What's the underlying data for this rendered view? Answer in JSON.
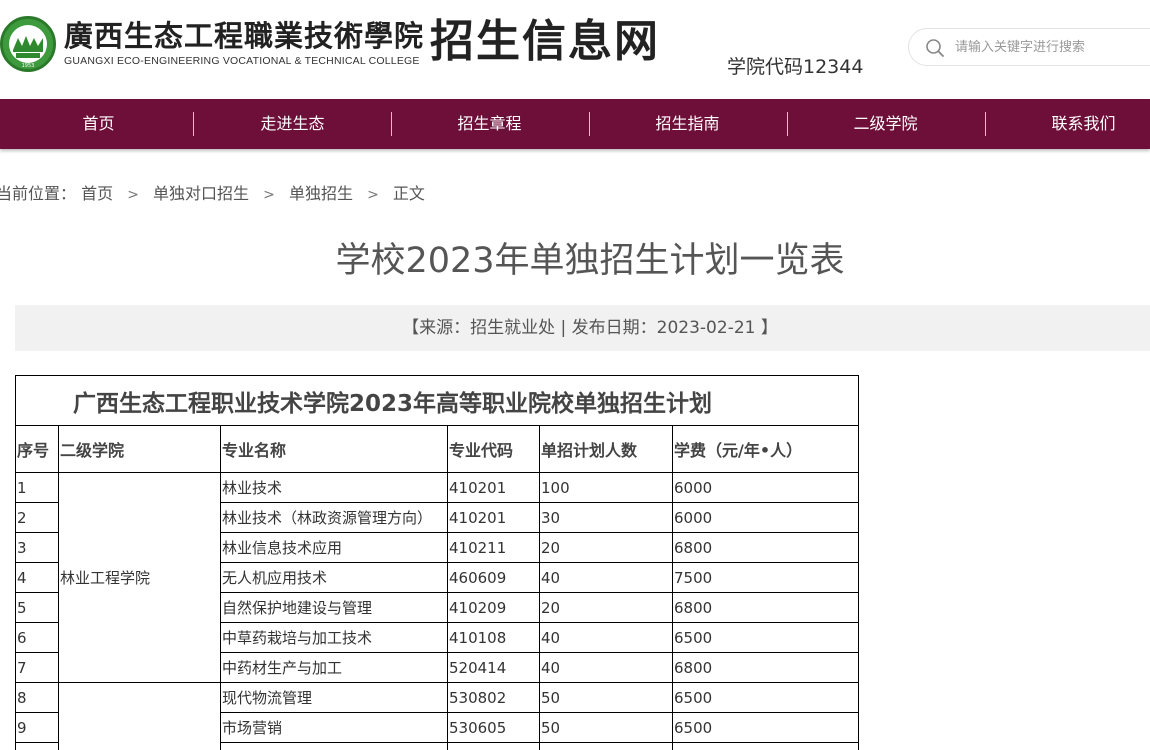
{
  "header": {
    "logo_cn": "廣西生态工程職業技術學院",
    "logo_en": "GUANGXI ECO-ENGINEERING VOCATIONAL & TECHNICAL COLLEGE",
    "logo_year": "1953",
    "site_title": "招生信息网",
    "school_code": "学院代码12344",
    "search_placeholder": "请输入关键字进行搜索",
    "search_icon": "search-icon"
  },
  "nav": {
    "items": [
      "首页",
      "走进生态",
      "招生章程",
      "招生指南",
      "二级学院",
      "联系我们"
    ]
  },
  "breadcrumb": {
    "prefix": "当前位置：",
    "items": [
      "首页",
      "单独对口招生",
      "单独招生",
      "正文"
    ]
  },
  "article": {
    "title": "学校2023年单独招生计划一览表",
    "meta": "【来源：招生就业处 | 发布日期：2023-02-21 】"
  },
  "table": {
    "caption": "广西生态工程职业技术学院2023年高等职业院校单独招生计划",
    "headers": [
      "序号",
      "二级学院",
      "专业名称",
      "专业代码",
      "单招计划人数",
      "学费（元/年•人）"
    ],
    "groups": [
      {
        "college": "林业工程学院",
        "rows": [
          {
            "no": "1",
            "major": "林业技术",
            "code": "410201",
            "plan": "100",
            "fee": "6000"
          },
          {
            "no": "2",
            "major": "林业技术（林政资源管理方向）",
            "code": "410201",
            "plan": "30",
            "fee": "6000"
          },
          {
            "no": "3",
            "major": "林业信息技术应用",
            "code": "410211",
            "plan": "20",
            "fee": "6800"
          },
          {
            "no": "4",
            "major": "无人机应用技术",
            "code": "460609",
            "plan": "40",
            "fee": "7500"
          },
          {
            "no": "5",
            "major": "自然保护地建设与管理",
            "code": "410209",
            "plan": "20",
            "fee": "6800"
          },
          {
            "no": "6",
            "major": "中草药栽培与加工技术",
            "code": "410108",
            "plan": "40",
            "fee": "6500"
          },
          {
            "no": "7",
            "major": "中药材生产与加工",
            "code": "520414",
            "plan": "40",
            "fee": "6800"
          }
        ]
      },
      {
        "college": "",
        "rows": [
          {
            "no": "8",
            "major": "现代物流管理",
            "code": "530802",
            "plan": "50",
            "fee": "6500"
          },
          {
            "no": "9",
            "major": "市场营销",
            "code": "530605",
            "plan": "50",
            "fee": "6500"
          }
        ]
      }
    ]
  },
  "colors": {
    "nav_bg": "#6e0f3a",
    "logo_green": "#3d9a3d",
    "meta_bg": "#f1f1f1"
  }
}
